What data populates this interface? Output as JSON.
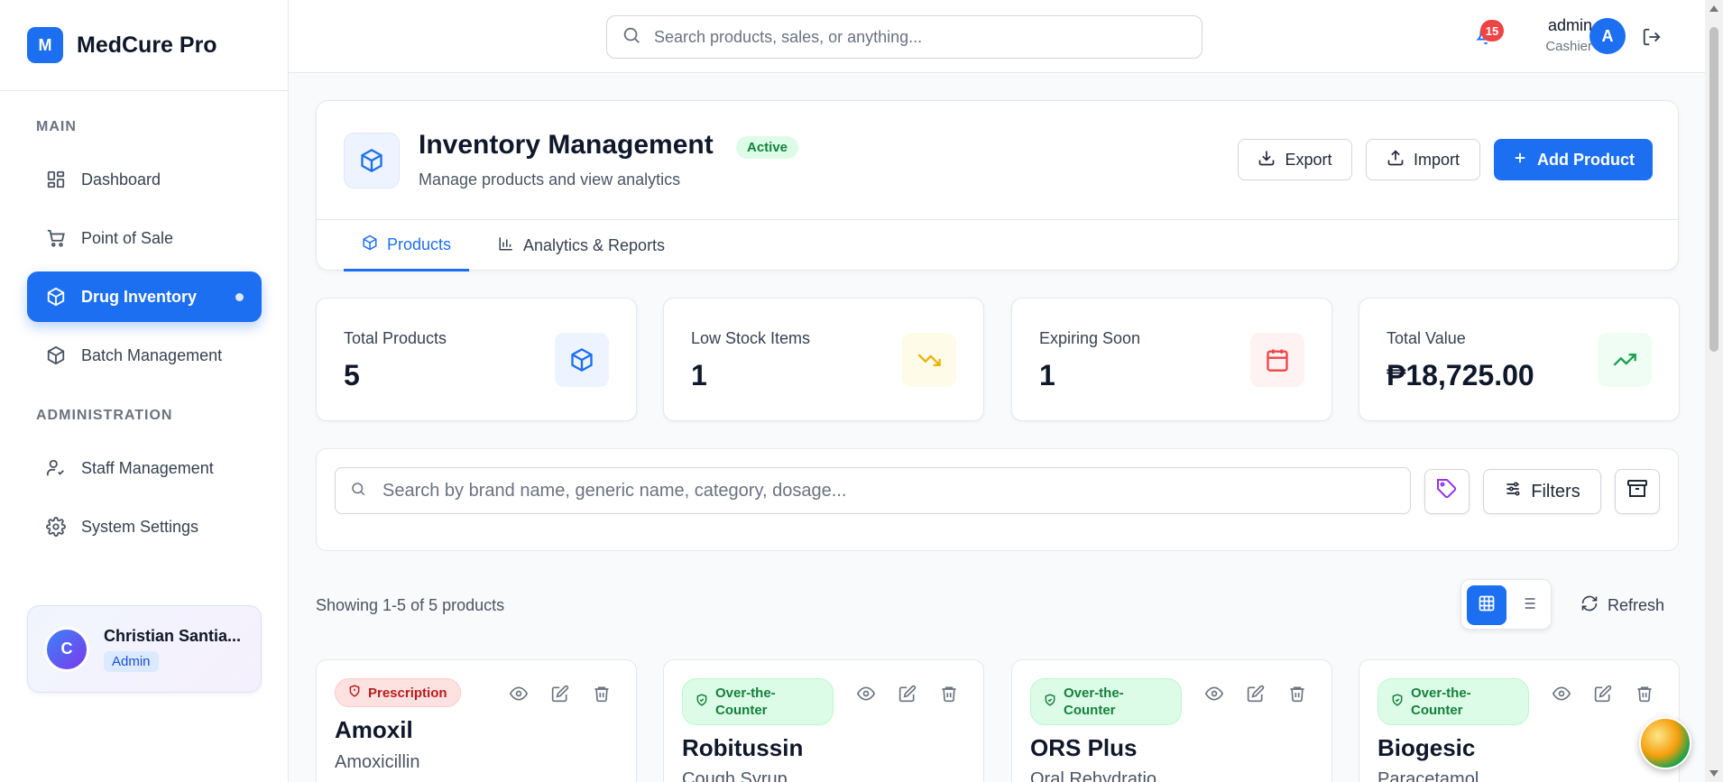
{
  "brand": {
    "logo_letter": "M",
    "name": "MedCure Pro"
  },
  "sidebar": {
    "main_label": "MAIN",
    "admin_label": "ADMINISTRATION",
    "items": [
      {
        "label": "Dashboard",
        "icon": "dashboard-icon"
      },
      {
        "label": "Point of Sale",
        "icon": "cart-icon"
      },
      {
        "label": "Drug Inventory",
        "icon": "box-icon",
        "active": true
      },
      {
        "label": "Batch Management",
        "icon": "box-icon"
      },
      {
        "label": "Staff Management",
        "icon": "user-check-icon"
      },
      {
        "label": "System Settings",
        "icon": "gear-icon"
      }
    ],
    "user": {
      "initial": "C",
      "name": "Christian Santia...",
      "role": "Admin"
    }
  },
  "topbar": {
    "search_placeholder": "Search products, sales, or anything...",
    "notification_count": "15",
    "user_name": "admin",
    "user_role": "Cashier",
    "avatar_initial": "A"
  },
  "header": {
    "title": "Inventory Management",
    "status_badge": "Active",
    "subtitle": "Manage products and view analytics",
    "export_label": "Export",
    "import_label": "Import",
    "add_label": "Add Product",
    "tabs": [
      {
        "label": "Products",
        "active": true
      },
      {
        "label": "Analytics & Reports"
      }
    ]
  },
  "stats": [
    {
      "label": "Total Products",
      "value": "5",
      "color": "#1d6ff2"
    },
    {
      "label": "Low Stock Items",
      "value": "1",
      "color": "#eab308"
    },
    {
      "label": "Expiring Soon",
      "value": "1",
      "color": "#ef4444"
    },
    {
      "label": "Total Value",
      "value": "₱18,725.00",
      "color": "#16a34a"
    }
  ],
  "filters": {
    "search_placeholder": "Search by brand name, generic name, category, dosage...",
    "filters_label": "Filters"
  },
  "listing": {
    "showing_text": "Showing 1-5 of 5 products",
    "refresh_label": "Refresh"
  },
  "products": [
    {
      "badge": "Prescription",
      "type": "rx",
      "name": "Amoxil",
      "generic": "Amoxicillin"
    },
    {
      "badge": "Over-the-Counter",
      "type": "otc",
      "name": "Robitussin",
      "generic": "Cough Syrup"
    },
    {
      "badge": "Over-the-Counter",
      "type": "otc",
      "name": "ORS Plus",
      "generic": "Oral Rehydratio"
    },
    {
      "badge": "Over-the-Counter",
      "type": "otc",
      "name": "Biogesic",
      "generic": "Paracetamol"
    }
  ],
  "colors": {
    "primary": "#1d6ff2",
    "success": "#16a34a",
    "danger": "#ef4444",
    "warning": "#eab308"
  }
}
